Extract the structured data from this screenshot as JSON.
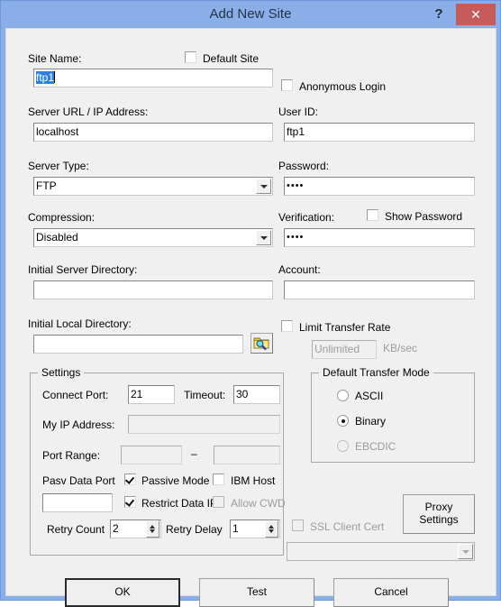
{
  "window": {
    "title": "Add New Site",
    "help_label": "?",
    "close_label": "✕",
    "accent_color": "#8aaee8",
    "close_color": "#c75b5b",
    "selection_color": "#2a7fe0"
  },
  "form": {
    "site_name_label": "Site Name:",
    "site_name_value": "ftp1",
    "default_site_label": "Default Site",
    "default_site_checked": false,
    "server_url_label": "Server URL / IP Address:",
    "server_url_value": "localhost",
    "server_type_label": "Server Type:",
    "server_type_value": "FTP",
    "compression_label": "Compression:",
    "compression_value": "Disabled",
    "initial_server_dir_label": "Initial Server Directory:",
    "initial_server_dir_value": "",
    "initial_local_dir_label": "Initial Local Directory:",
    "initial_local_dir_value": "",
    "browse_icon": "folder-search-icon",
    "anonymous_login_label": "Anonymous Login",
    "anonymous_login_checked": false,
    "user_id_label": "User ID:",
    "user_id_value": "ftp1",
    "password_label": "Password:",
    "password_value": "••••",
    "show_password_label": "Show Password",
    "show_password_checked": false,
    "verification_label": "Verification:",
    "verification_value": "••••",
    "account_label": "Account:",
    "account_value": "",
    "limit_transfer_rate_label": "Limit Transfer Rate",
    "limit_transfer_rate_checked": false,
    "rate_value": "Unlimited",
    "rate_units_label": "KB/sec"
  },
  "settings": {
    "group_title": "Settings",
    "connect_port_label": "Connect Port:",
    "connect_port_value": "21",
    "timeout_label": "Timeout:",
    "timeout_value": "30",
    "my_ip_label": "My IP Address:",
    "my_ip_value": "",
    "port_range_label": "Port Range:",
    "port_range_from": "",
    "port_range_separator": "–",
    "port_range_to": "",
    "pasv_data_port_label": "Pasv Data Port",
    "pasv_data_port_value": "",
    "passive_mode_label": "Passive Mode",
    "passive_mode_checked": true,
    "ibm_host_label": "IBM Host",
    "ibm_host_checked": false,
    "restrict_data_ip_label": "Restrict Data IP",
    "restrict_data_ip_checked": true,
    "allow_cwd_label": "Allow CWD",
    "allow_cwd_checked": false,
    "retry_count_label": "Retry Count",
    "retry_count_value": "2",
    "retry_delay_label": "Retry Delay",
    "retry_delay_value": "1"
  },
  "transfer_mode": {
    "group_title": "Default Transfer Mode",
    "options": [
      {
        "label": "ASCII",
        "selected": false,
        "disabled": false
      },
      {
        "label": "Binary",
        "selected": true,
        "disabled": false
      },
      {
        "label": "EBCDIC",
        "selected": false,
        "disabled": true
      }
    ]
  },
  "ssl": {
    "ssl_client_cert_label": "SSL Client Cert",
    "ssl_client_cert_checked": false,
    "cert_select_value": "",
    "proxy_settings_label_line1": "Proxy",
    "proxy_settings_label_line2": "Settings"
  },
  "footer": {
    "ok_label": "OK",
    "test_label": "Test",
    "cancel_label": "Cancel"
  }
}
